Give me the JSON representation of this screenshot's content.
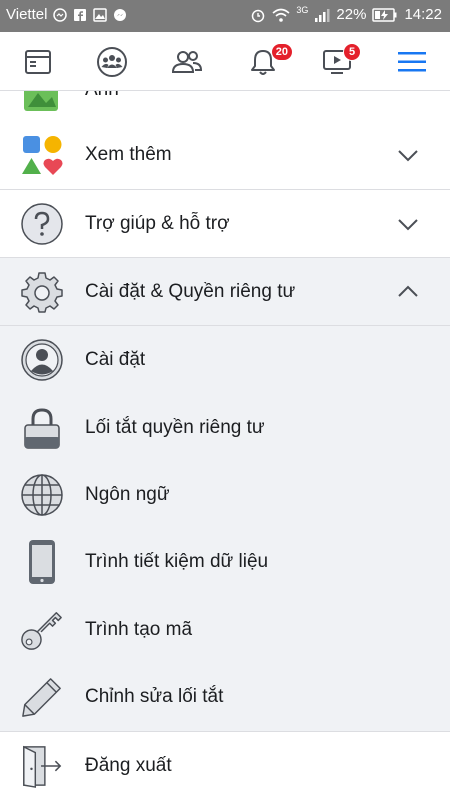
{
  "status_bar": {
    "carrier": "Viettel",
    "network": "3G",
    "battery": "22%",
    "time": "14:22"
  },
  "nav": {
    "items": [
      {
        "name": "news-feed"
      },
      {
        "name": "groups"
      },
      {
        "name": "friends"
      },
      {
        "name": "notifications",
        "badge": "20"
      },
      {
        "name": "watch",
        "badge": "5"
      },
      {
        "name": "menu"
      }
    ],
    "active_color": "#1877f2"
  },
  "menu": {
    "partial_label": "Ảnh",
    "see_more": "Xem thêm",
    "help": "Trợ giúp & hỗ trợ",
    "settings_privacy": "Cài đặt & Quyền riêng tư",
    "settings": "Cài đặt",
    "privacy_shortcuts": "Lối tắt quyền riêng tư",
    "language": "Ngôn ngữ",
    "data_saver": "Trình tiết kiệm dữ liệu",
    "code_generator": "Trình tạo mã",
    "edit_shortcuts": "Chỉnh sửa lối tắt",
    "logout": "Đăng xuất"
  }
}
